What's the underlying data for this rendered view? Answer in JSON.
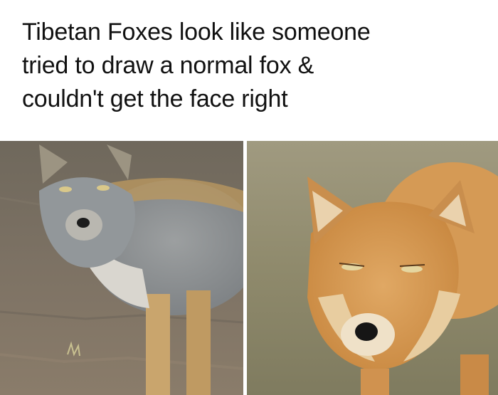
{
  "caption": {
    "line1": "Tibetan Foxes look like someone",
    "line2": "tried to draw a normal fox &",
    "line3": "couldn't get the face right"
  },
  "colors": {
    "left_ground": "#7a6f62",
    "left_fur_gray": "#8e9193",
    "left_fur_tan": "#c7a26a",
    "right_background": "#8f8a6c",
    "right_fur_orange": "#d69a55",
    "right_fur_cream": "#e7c89a"
  },
  "photos": [
    {
      "subject": "gray-tibetan-fox"
    },
    {
      "subject": "orange-tibetan-fox-closeup"
    }
  ]
}
